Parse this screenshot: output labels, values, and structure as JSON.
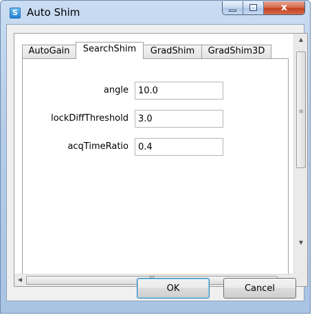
{
  "window": {
    "title": "Auto Shim",
    "app_icon_glyph": "S"
  },
  "caption": {
    "close_glyph": "x"
  },
  "tabs": [
    {
      "label": "AutoGain",
      "active": false
    },
    {
      "label": "SearchShim",
      "active": true
    },
    {
      "label": "GradShim",
      "active": false
    },
    {
      "label": "GradShim3D",
      "active": false
    }
  ],
  "fields": [
    {
      "label": "angle",
      "value": "10.0"
    },
    {
      "label": "lockDiffThreshold",
      "value": "3.0"
    },
    {
      "label": "acqTimeRatio",
      "value": "0.4"
    }
  ],
  "scrollbars": {
    "grip": "III",
    "v_grip": "≡",
    "up": "▲",
    "down": "▼",
    "left": "◀",
    "right": "▶"
  },
  "buttons": {
    "ok": "OK",
    "cancel": "Cancel"
  },
  "colors": {
    "titlebar": "#b6cde8",
    "close": "#c2401f",
    "default_button_border": "#3c7fb1"
  }
}
